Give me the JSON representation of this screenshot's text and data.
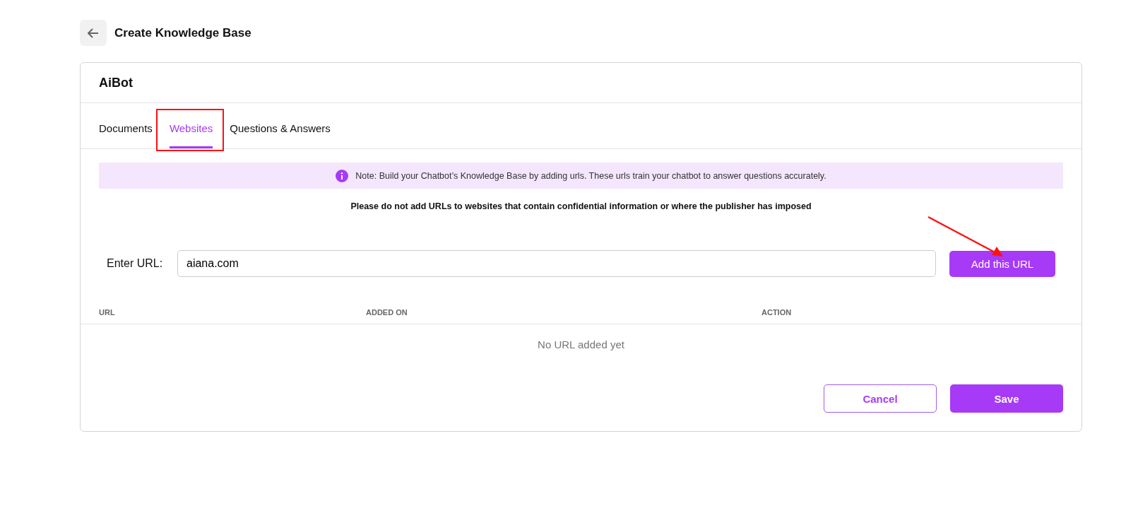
{
  "page": {
    "title": "Create Knowledge Base"
  },
  "card": {
    "title": "AiBot"
  },
  "tabs": [
    {
      "label": "Documents",
      "selected": false
    },
    {
      "label": "Websites",
      "selected": true
    },
    {
      "label": "Questions & Answers",
      "selected": false
    }
  ],
  "note": "Note: Build your Chatbot’s Knowledge Base by adding urls. These urls train your chatbot to answer questions accurately.",
  "warning": "Please do not add URLs to websites that contain confidential information or where the publisher has imposed",
  "url_field": {
    "label": "Enter URL:",
    "value": "aiana.com"
  },
  "add_button": "Add this URL",
  "table": {
    "columns": [
      "URL",
      "ADDED ON",
      "ACTION"
    ],
    "empty": "No URL added yet"
  },
  "buttons": {
    "cancel": "Cancel",
    "save": "Save"
  }
}
